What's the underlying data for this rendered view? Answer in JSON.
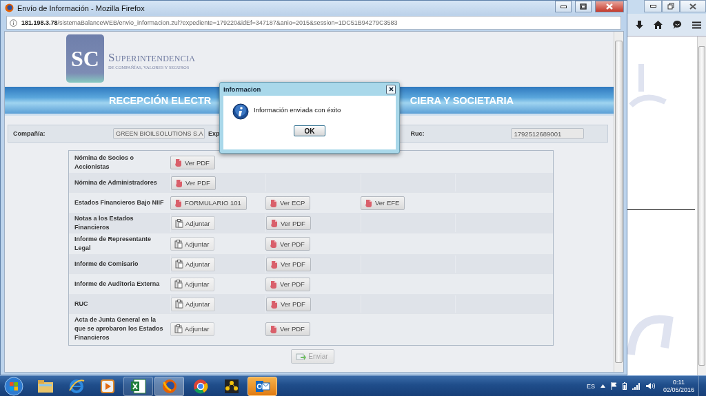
{
  "popup_window": {
    "title": "Envío de Información - Mozilla Firefox",
    "url_host": "181.198.3.78",
    "url_path": "/sistemaBalanceWEB/envio_informacion.zul?expediente=179220&idEf=347187&anio=2015&session=1DC51B94279C3583",
    "logo": {
      "monogram": "SC",
      "name": "SUPERINTENDENCIA",
      "subtitle": "DE COMPAÑÍAS, VALORES Y SEGUROS"
    },
    "banner": {
      "title_left": "RECEPCIÓN ELECTR",
      "title_right": "CIERA Y SOCIETARIA"
    },
    "info": {
      "company_label": "Compañía:",
      "company_value": "GREEN BIOILSOLUTIONS S.A",
      "file_label": "Exp",
      "ruc_label": "Ruc:",
      "ruc_value": "1792512689001"
    },
    "documents": [
      {
        "label": "Nómina de Socios o Accionistas",
        "buttons": [
          {
            "kind": "pdf",
            "label": "Ver PDF"
          }
        ]
      },
      {
        "label": "Nómina de Administradores",
        "buttons": [
          {
            "kind": "pdf",
            "label": "Ver PDF"
          }
        ]
      },
      {
        "label": "Estados Financieros Bajo NIIF",
        "buttons": [
          {
            "kind": "pdf",
            "label": "FORMULARIO 101"
          },
          {
            "kind": "pdf",
            "label": "Ver ECP"
          },
          {
            "kind": "pdf",
            "label": "Ver EFE"
          }
        ]
      },
      {
        "label": "Notas a los Estados Financieros",
        "buttons": [
          {
            "kind": "attach",
            "label": "Adjuntar"
          },
          {
            "kind": "pdf",
            "label": "Ver PDF"
          }
        ]
      },
      {
        "label": "Informe de Representante Legal",
        "buttons": [
          {
            "kind": "attach",
            "label": "Adjuntar"
          },
          {
            "kind": "pdf",
            "label": "Ver PDF"
          }
        ]
      },
      {
        "label": "Informe de Comisario",
        "buttons": [
          {
            "kind": "attach",
            "label": "Adjuntar"
          },
          {
            "kind": "pdf",
            "label": "Ver PDF"
          }
        ]
      },
      {
        "label": "Informe de Auditoria Externa",
        "buttons": [
          {
            "kind": "attach",
            "label": "Adjuntar"
          },
          {
            "kind": "pdf",
            "label": "Ver PDF"
          }
        ]
      },
      {
        "label": "RUC",
        "buttons": [
          {
            "kind": "attach",
            "label": "Adjuntar"
          },
          {
            "kind": "pdf",
            "label": "Ver PDF"
          }
        ]
      },
      {
        "label": "Acta de Junta General en la que se aprobaron los Estados Financieros",
        "buttons": [
          {
            "kind": "attach",
            "label": "Adjuntar"
          },
          {
            "kind": "pdf",
            "label": "Ver PDF"
          }
        ]
      }
    ],
    "send_button": {
      "label": "Enviar",
      "disabled": true
    }
  },
  "dialog": {
    "title": "Informacion",
    "message": "Información enviada con éxito",
    "ok": "OK"
  },
  "taskbar": {
    "apps": [
      {
        "running": false,
        "active": false,
        "attention": false
      },
      {
        "running": false,
        "active": false,
        "attention": false
      },
      {
        "running": false,
        "active": false,
        "attention": false
      },
      {
        "running": true,
        "active": false,
        "attention": false
      },
      {
        "running": true,
        "active": true,
        "attention": false
      },
      {
        "running": false,
        "active": false,
        "attention": false
      },
      {
        "running": false,
        "active": false,
        "attention": false
      },
      {
        "running": true,
        "active": false,
        "attention": true
      }
    ],
    "language": "ES",
    "time": "0:11",
    "date": "02/05/2016"
  }
}
